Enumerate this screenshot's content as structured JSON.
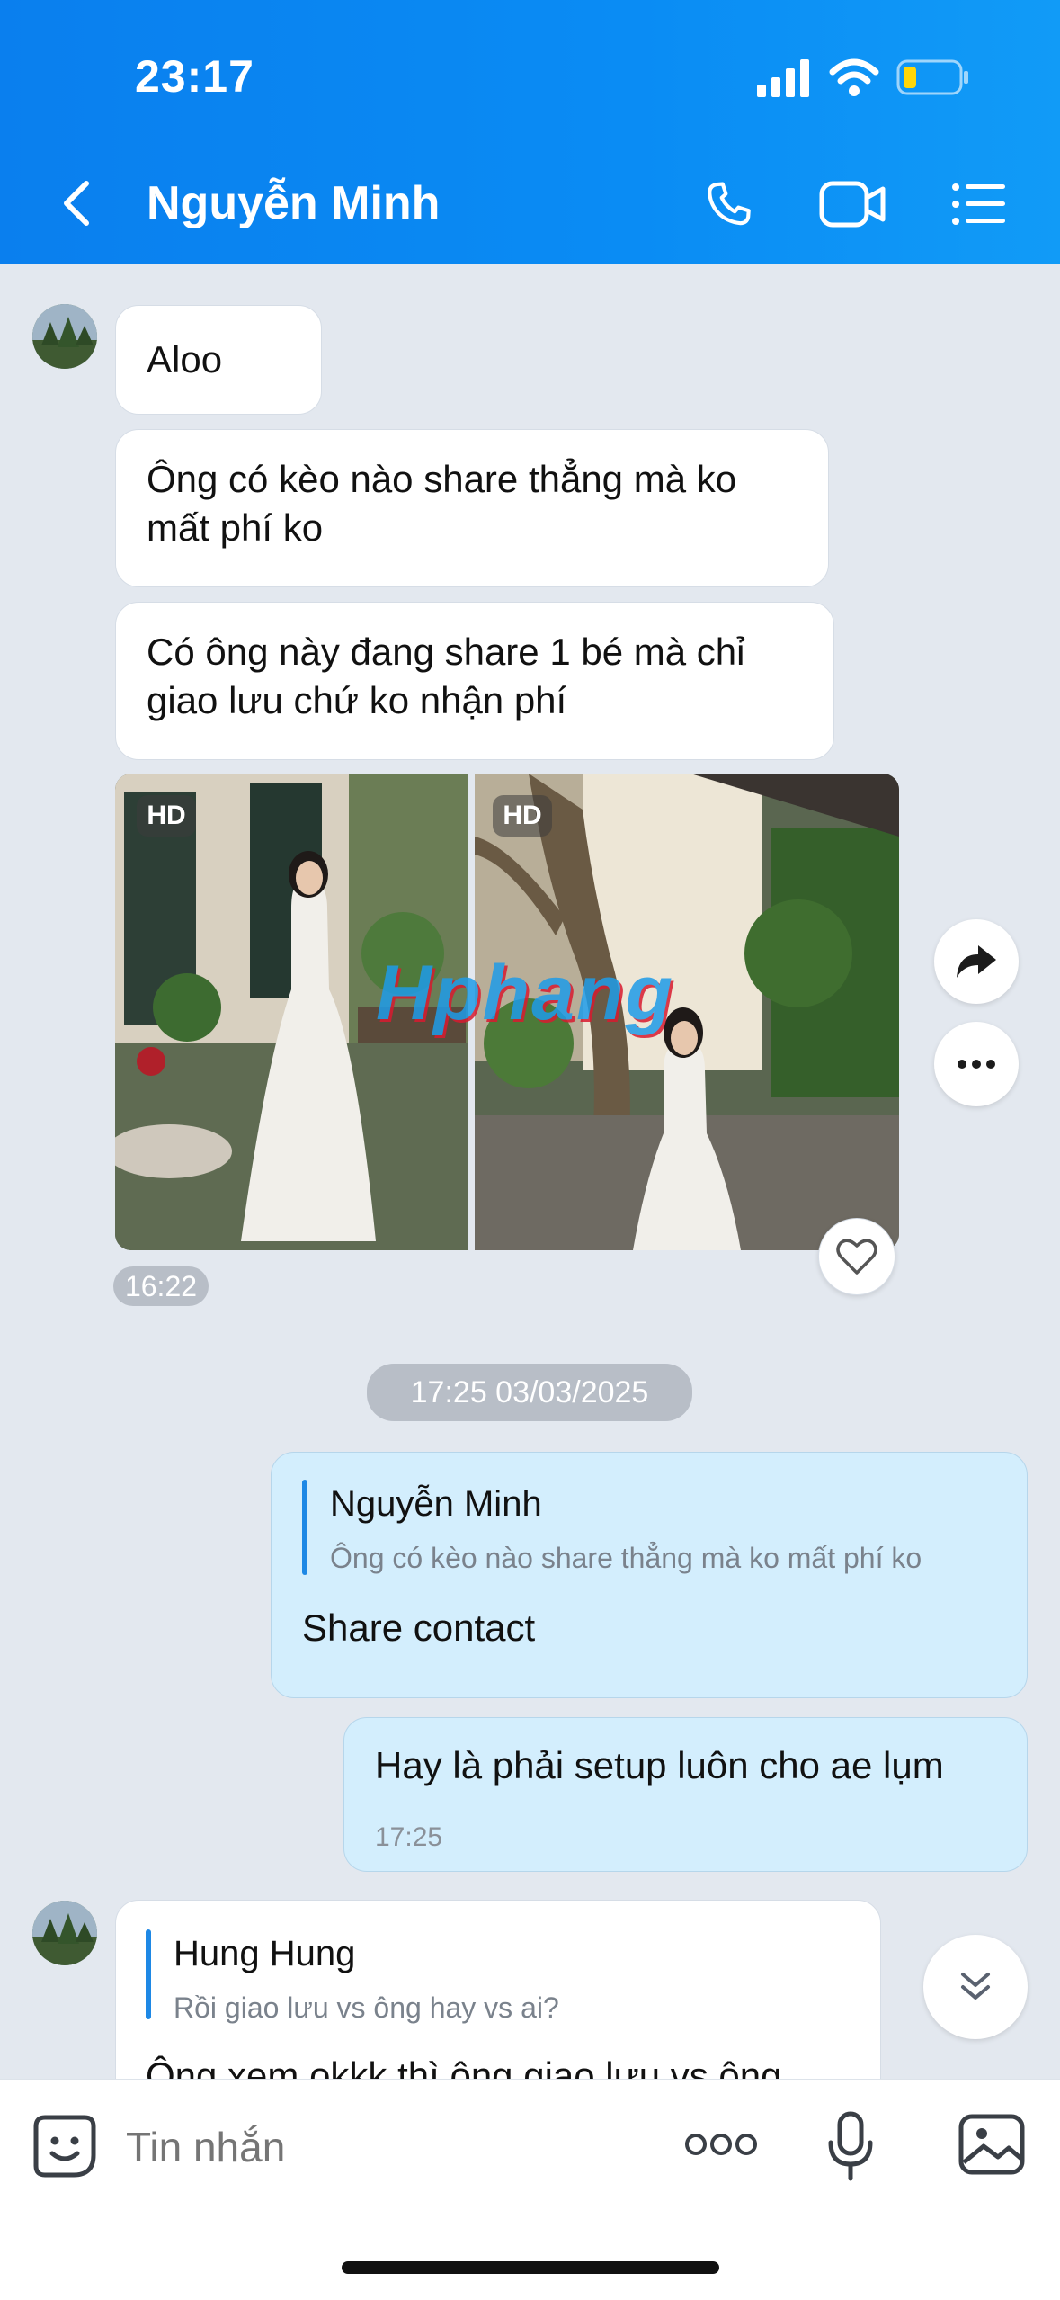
{
  "status_bar": {
    "time": "23:17"
  },
  "header": {
    "contact_name": "Nguyễn Minh"
  },
  "messages": {
    "m1": "Aloo",
    "m2_line1": "Ông có kèo nào share thẳng mà ko",
    "m2_line2": "mất phí ko",
    "m3_line1": "Có ông này đang share 1 bé mà chỉ",
    "m3_line2": "giao lưu chứ ko nhận phí",
    "photo_badge_1": "HD",
    "photo_badge_2": "HD",
    "watermark": "Hphang",
    "photo_time": "16:22",
    "date_divider": "17:25 03/03/2025",
    "reply1_quote_name": "Nguyễn Minh",
    "reply1_quote_text": "Ông có kèo nào share thẳng mà ko mất phí ko",
    "reply1_text": "Share contact",
    "m4_text": "Hay là phải setup luôn cho ae lụm",
    "m4_time": "17:25",
    "reply2_quote_name": "Hung Hung",
    "reply2_quote_text": "Rồi giao lưu vs ông hay vs ai?",
    "reply2_text": "Ông xem okkk thì ông giao lưu vs ông"
  },
  "input": {
    "placeholder": "Tin nhắn"
  },
  "icons": [
    "back-icon",
    "phone-icon",
    "video-call-icon",
    "menu-list-icon",
    "share-forward-icon",
    "more-options-icon",
    "heart-icon",
    "scroll-down-icon",
    "sticker-icon",
    "more-dots-icon",
    "microphone-icon",
    "gallery-icon"
  ],
  "colors": {
    "header_blue": "#0a86f2",
    "chat_bg": "#e3e8ef",
    "my_bubble": "#d3eefd",
    "quote_bar": "#1e88e5"
  }
}
